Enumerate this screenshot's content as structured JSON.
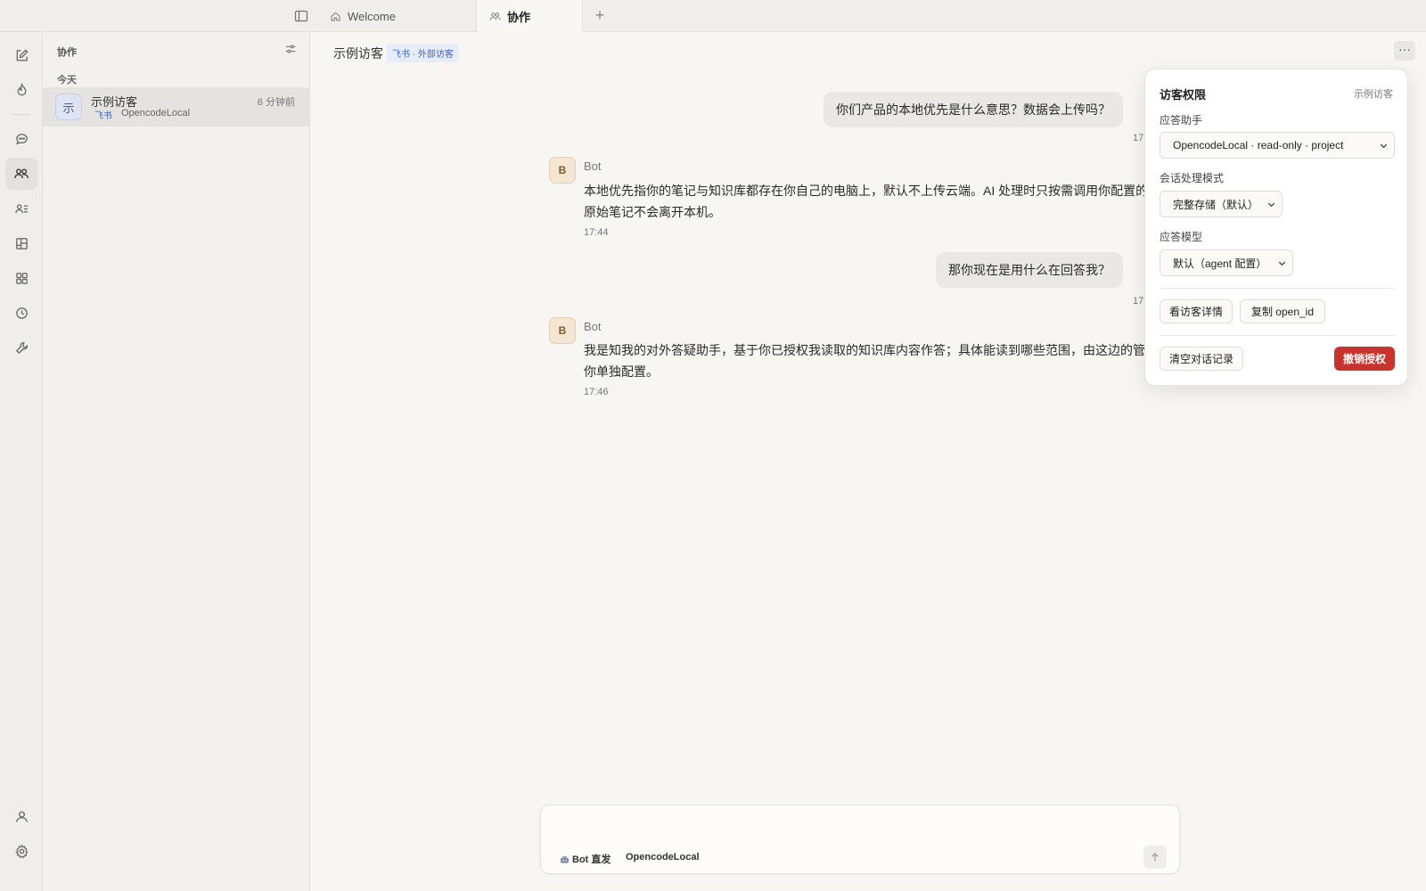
{
  "tabs": [
    {
      "label": "Welcome",
      "icon": "home-icon"
    },
    {
      "label": "协作",
      "icon": "people-icon"
    }
  ],
  "sidebar": {
    "header": "协作",
    "group_label": "今天",
    "conversations": [
      {
        "avatar": "示",
        "name": "示例访客",
        "time": "6 分钟前",
        "source": "飞书",
        "agent": "OpencodeLocal"
      }
    ]
  },
  "main": {
    "title": "示例访客",
    "badge": "飞书 · 外部访客",
    "messages": [
      {
        "role": "user",
        "text": "你们产品的本地优先是什么意思？数据会上传吗？",
        "time": "17"
      },
      {
        "role": "bot",
        "avatar": "B",
        "name": "Bot",
        "lines": [
          "本地优先指你的笔记与知识库都存在你自己的电脑上，默认不上传云端。AI 处理时只按需调用你配置的",
          "原始笔记不会离开本机。"
        ],
        "time": "17:44"
      },
      {
        "role": "user",
        "text": "那你现在是用什么在回答我？",
        "time": "17"
      },
      {
        "role": "bot",
        "avatar": "B",
        "name": "Bot",
        "lines": [
          "我是知我的对外答疑助手，基于你已授权我读取的知识库内容作答；具体能读到哪些范围，由这边的管",
          "你单独配置。"
        ],
        "time": "17:46"
      }
    ]
  },
  "composer": {
    "placeholder": "",
    "mode_label": "Bot 直发",
    "agent_label": "OpencodeLocal"
  },
  "popover": {
    "title": "访客权限",
    "subtitle": "示例访客",
    "assistant_label": "应答助手",
    "assistant_value": "OpencodeLocal · read-only · project",
    "mode_label": "会话处理模式",
    "mode_value": "完整存储（默认）",
    "model_label": "应答模型",
    "model_value": "默认（agent 配置）",
    "btn_details": "看访客详情",
    "btn_copy": "复制 open_id",
    "btn_clear": "清空对话记录",
    "btn_revoke": "撤销授权"
  },
  "colors": {
    "accent_link": "#3b63d8",
    "danger": "#c8342d"
  }
}
